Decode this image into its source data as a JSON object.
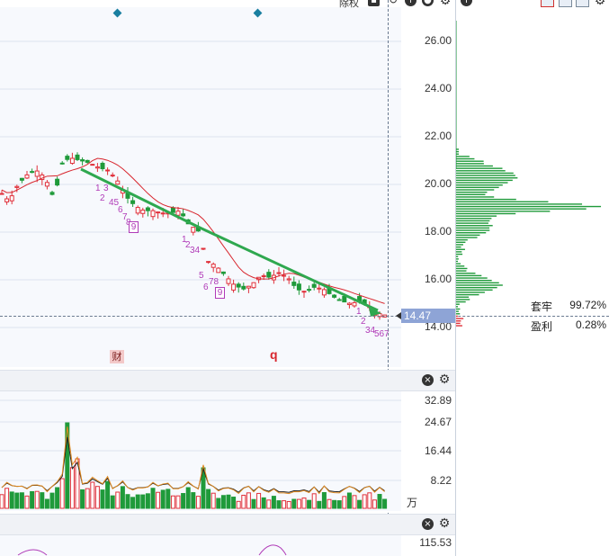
{
  "toolbar": {
    "label": "除权",
    "info_icon": "info-icon",
    "settings_icon": "gear-icon"
  },
  "main_chart": {
    "price_axis": [
      "26.00",
      "24.00",
      "22.00",
      "20.00",
      "18.00",
      "16.00",
      "14.00"
    ],
    "current_price": "14.47",
    "event_badge": "财",
    "event_q": "q",
    "td_badge_1": "9",
    "td_badge_2": "9",
    "seq_labels_1": [
      "1",
      "3",
      "2",
      "45",
      "6",
      "7",
      "8"
    ],
    "seq_labels_2": [
      "1",
      "2",
      "34",
      "5",
      "6",
      "78"
    ],
    "seq_labels_3": [
      "1",
      "2",
      "34",
      "567"
    ],
    "colors": {
      "up": "#e0303a",
      "down": "#1f9a3a",
      "trend": "#2fa84f",
      "ma": "#d8262e",
      "seq": "#b03bb8"
    }
  },
  "chip_distribution": {
    "trapped_label": "套牢",
    "trapped_value": "99.72%",
    "profit_label": "盈利",
    "profit_value": "0.28%"
  },
  "volume_panel": {
    "axis": [
      "32.89",
      "24.67",
      "16.44",
      "8.22"
    ],
    "unit": "万"
  },
  "indicator_panel": {
    "axis_top": "115.53"
  }
}
